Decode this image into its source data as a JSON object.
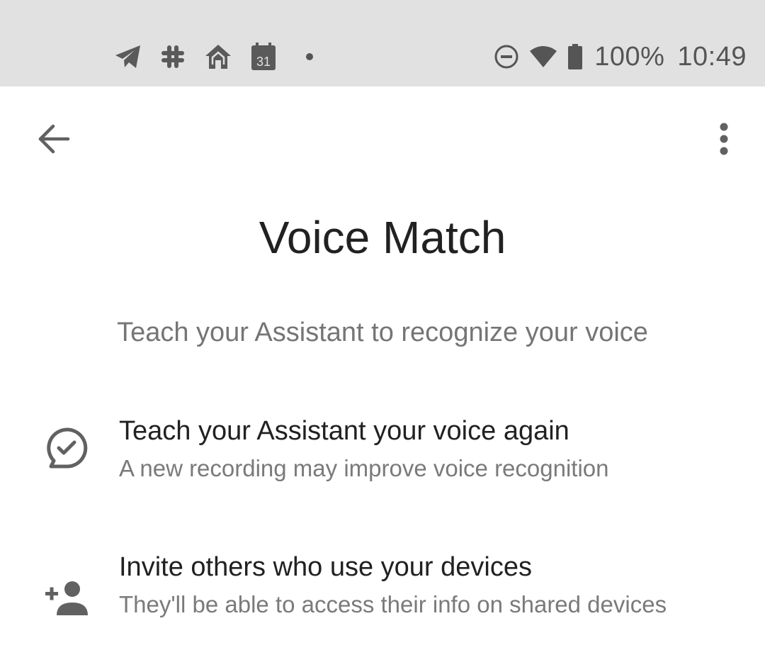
{
  "status_bar": {
    "left_icons": [
      "telegram-icon",
      "slack-icon",
      "home-icon",
      "calendar-icon"
    ],
    "calendar_day": "31",
    "right_icons": [
      "do-not-disturb-icon",
      "wifi-icon",
      "battery-icon"
    ],
    "battery_percent": "100%",
    "time": "10:49"
  },
  "toolbar": {
    "back_icon": "arrow-back-icon",
    "more_icon": "more-vert-icon"
  },
  "page": {
    "title": "Voice Match",
    "subtitle": "Teach your Assistant to recognize your voice"
  },
  "items": [
    {
      "icon": "voice-check-icon",
      "title": "Teach your Assistant your voice again",
      "description": "A new recording may improve voice recognition"
    },
    {
      "icon": "person-add-icon",
      "title": "Invite others who use your devices",
      "description": "They'll be able to access their info on shared devices"
    }
  ],
  "colors": {
    "status_bar_bg": "#e1e1e1",
    "icon_gray": "#616161",
    "title_text": "#212121",
    "secondary_text": "#757575"
  }
}
